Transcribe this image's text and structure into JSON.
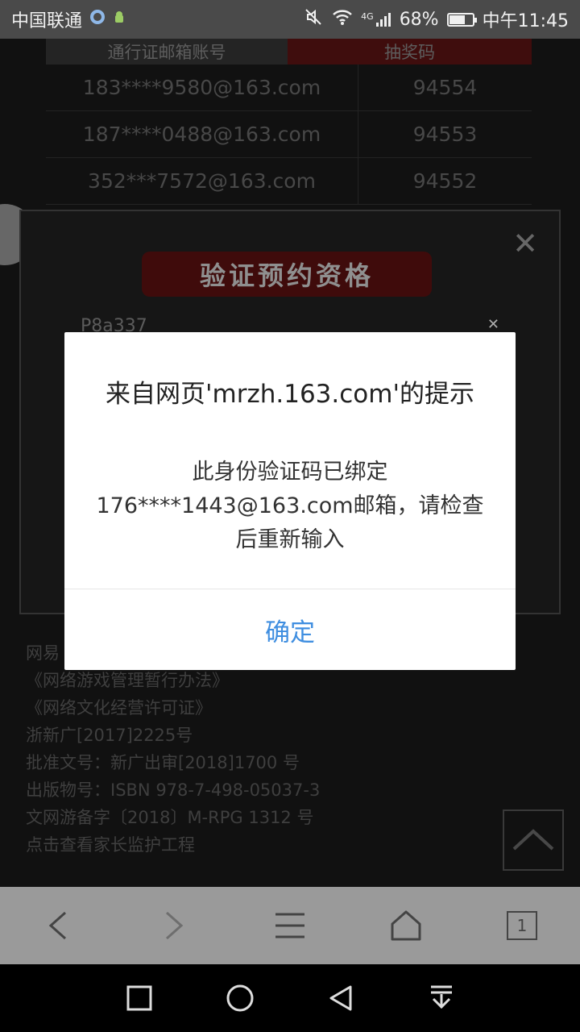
{
  "status_bar": {
    "carrier": "中国联通",
    "network": "4G",
    "battery": "68%",
    "battery_level": 0.68,
    "time": "中午11:45"
  },
  "page": {
    "table_headers": [
      "通行证邮箱账号",
      "抽奖码"
    ],
    "rows": [
      {
        "email": "183****9580@163.com",
        "code": "94554"
      },
      {
        "email": "187****0488@163.com",
        "code": "94553"
      },
      {
        "email": "352***7572@163.com",
        "code": "94552"
      }
    ],
    "panel_title": "验证预约资格",
    "code_input_value": "P8a337",
    "footer_lines": [
      "网易",
      "《网络游戏管理暂行办法》",
      "《网络文化经营许可证》",
      "浙新广[2017]2225号",
      "批准文号：新广出审[2018]1700 号",
      "出版物号：ISBN 978-7-498-05037-3",
      "文网游备字〔2018〕M-RPG 1312 号",
      "点击查看家长监护工程"
    ]
  },
  "dialog": {
    "title": "来自网页'mrzh.163.com'的提示",
    "message": "此身份验证码已绑定176****1443@163.com邮箱，请检查后重新输入",
    "ok_label": "确定"
  },
  "toolbar": {
    "tab_count": "1"
  },
  "colors": {
    "accent": "#3f8ee0",
    "status_bar_bg": "#4a4a4a",
    "toolbar_bg": "#9a9a9a"
  }
}
